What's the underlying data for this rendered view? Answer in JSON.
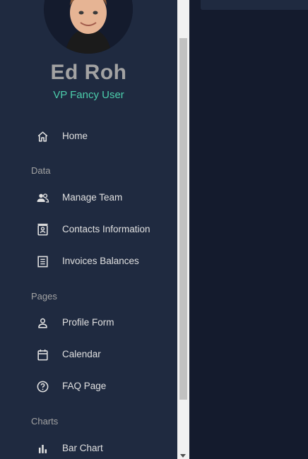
{
  "profile": {
    "name": "Ed Roh",
    "role": "VP Fancy User"
  },
  "nav": {
    "home": {
      "label": "Home",
      "icon": "home-icon"
    },
    "sections": {
      "data": "Data",
      "pages": "Pages",
      "charts": "Charts"
    },
    "data_items": [
      {
        "label": "Manage Team",
        "icon": "people-icon"
      },
      {
        "label": "Contacts Information",
        "icon": "contact-card-icon"
      },
      {
        "label": "Invoices Balances",
        "icon": "receipt-icon"
      }
    ],
    "pages_items": [
      {
        "label": "Profile Form",
        "icon": "person-icon"
      },
      {
        "label": "Calendar",
        "icon": "calendar-icon"
      },
      {
        "label": "FAQ Page",
        "icon": "help-circle-icon"
      }
    ],
    "charts_items": [
      {
        "label": "Bar Chart",
        "icon": "bar-chart-icon"
      }
    ]
  },
  "colors": {
    "sidebar_bg": "#1f2a40",
    "main_bg": "#141b2d",
    "accent_green": "#4cceac",
    "text_primary": "#e0e0e0",
    "text_muted": "#a3a3a3"
  }
}
